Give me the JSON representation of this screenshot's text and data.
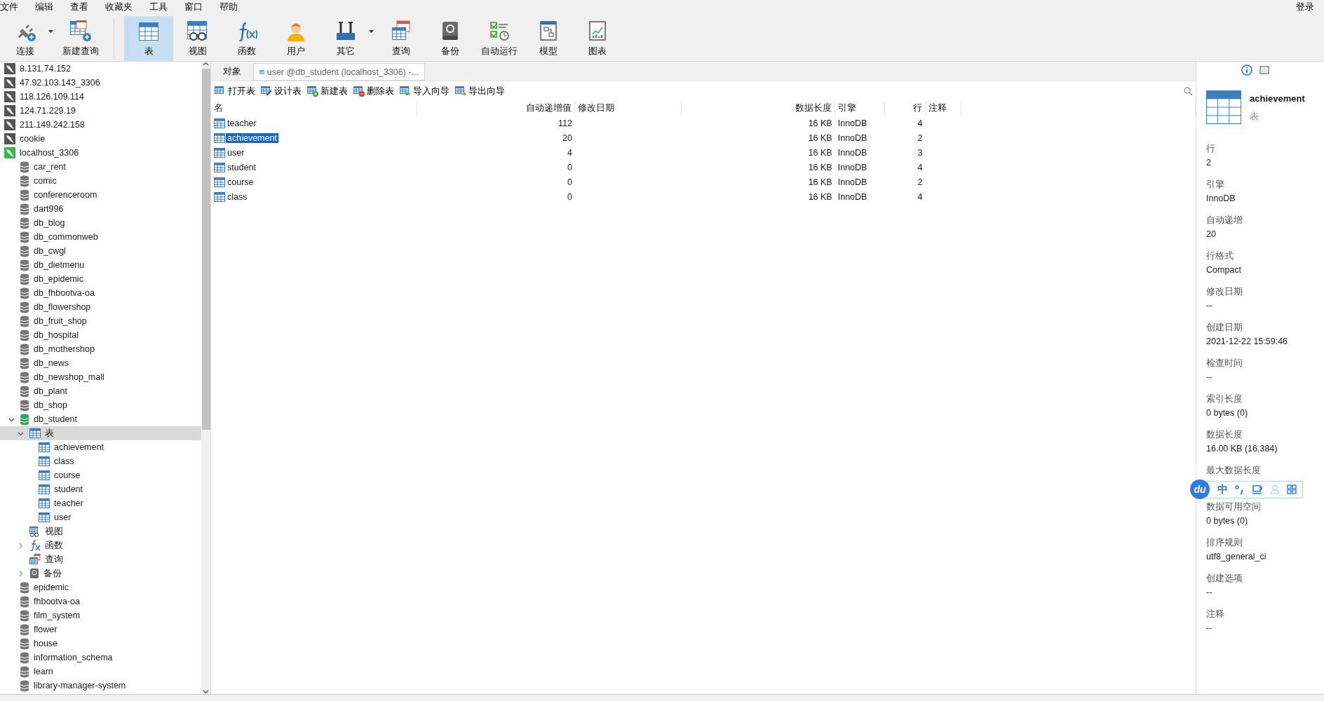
{
  "menu": [
    "文件",
    "编辑",
    "查看",
    "收藏夹",
    "工具",
    "窗口",
    "帮助"
  ],
  "login": "登录",
  "toolbar": [
    {
      "label": "连接",
      "kind": "plug",
      "dropdown": true,
      "selected": false
    },
    {
      "label": "新建查询",
      "kind": "newquery",
      "dropdown": false,
      "selected": false
    },
    {
      "label": "表",
      "kind": "table",
      "dropdown": false,
      "selected": true
    },
    {
      "label": "视图",
      "kind": "view",
      "dropdown": false,
      "selected": false
    },
    {
      "label": "函数",
      "kind": "func",
      "dropdown": false,
      "selected": false
    },
    {
      "label": "用户",
      "kind": "user",
      "dropdown": false,
      "selected": false
    },
    {
      "label": "其它",
      "kind": "tools",
      "dropdown": true,
      "selected": false
    },
    {
      "label": "查询",
      "kind": "query",
      "dropdown": false,
      "selected": false
    },
    {
      "label": "备份",
      "kind": "backup",
      "dropdown": false,
      "selected": false
    },
    {
      "label": "自动运行",
      "kind": "auto",
      "dropdown": false,
      "selected": false
    },
    {
      "label": "模型",
      "kind": "model",
      "dropdown": false,
      "selected": false
    },
    {
      "label": "图表",
      "kind": "chart",
      "dropdown": false,
      "selected": false
    }
  ],
  "tree": [
    {
      "label": "8.131.74.152",
      "kind": "connection",
      "active": false
    },
    {
      "label": "47.92.103.143_3306",
      "kind": "connection",
      "active": false
    },
    {
      "label": "118.126.109.114",
      "kind": "connection",
      "active": false
    },
    {
      "label": "124.71.229.19",
      "kind": "connection",
      "active": false
    },
    {
      "label": "211.149.242.158",
      "kind": "connection",
      "active": false
    },
    {
      "label": "cookie",
      "kind": "connection",
      "active": false
    },
    {
      "label": "localhost_3306",
      "kind": "connection",
      "active": true,
      "children": [
        {
          "label": "car_rent",
          "kind": "database",
          "active": false
        },
        {
          "label": "comic",
          "kind": "database",
          "active": false
        },
        {
          "label": "conferenceroom",
          "kind": "database",
          "active": false
        },
        {
          "label": "dart996",
          "kind": "database",
          "active": false
        },
        {
          "label": "db_blog",
          "kind": "database",
          "active": false
        },
        {
          "label": "db_commonweb",
          "kind": "database",
          "active": false
        },
        {
          "label": "db_cwgl",
          "kind": "database",
          "active": false
        },
        {
          "label": "db_dietmenu",
          "kind": "database",
          "active": false
        },
        {
          "label": "db_epidemic",
          "kind": "database",
          "active": false
        },
        {
          "label": "db_fhbootva-oa",
          "kind": "database",
          "active": false
        },
        {
          "label": "db_flowershop",
          "kind": "database",
          "active": false
        },
        {
          "label": "db_fruit_shop",
          "kind": "database",
          "active": false
        },
        {
          "label": "db_hospital",
          "kind": "database",
          "active": false
        },
        {
          "label": "db_mothershop",
          "kind": "database",
          "active": false
        },
        {
          "label": "db_news",
          "kind": "database",
          "active": false
        },
        {
          "label": "db_newshop_mall",
          "kind": "database",
          "active": false
        },
        {
          "label": "db_plant",
          "kind": "database",
          "active": false
        },
        {
          "label": "db_shop",
          "kind": "database",
          "active": false
        },
        {
          "label": "db_student",
          "kind": "database",
          "active": true,
          "expanded": true,
          "children": [
            {
              "label": "表",
              "kind": "tables",
              "expanded": true,
              "selected": true,
              "children": [
                {
                  "label": "achievement",
                  "kind": "table",
                  "selected": false
                },
                {
                  "label": "class",
                  "kind": "table",
                  "selected": false
                },
                {
                  "label": "course",
                  "kind": "table",
                  "selected": false
                },
                {
                  "label": "student",
                  "kind": "table",
                  "selected": false
                },
                {
                  "label": "teacher",
                  "kind": "table",
                  "selected": false
                },
                {
                  "label": "user",
                  "kind": "table",
                  "selected": false
                }
              ]
            },
            {
              "label": "视图",
              "kind": "views",
              "selected": false
            },
            {
              "label": "函数",
              "kind": "functions",
              "expanded": false,
              "selected": false
            },
            {
              "label": "查询",
              "kind": "queries",
              "selected": false
            },
            {
              "label": "备份",
              "kind": "backups",
              "expanded": false,
              "selected": false
            }
          ]
        },
        {
          "label": "epidemic",
          "kind": "database",
          "active": false
        },
        {
          "label": "fhbootva-oa",
          "kind": "database",
          "active": false
        },
        {
          "label": "film_system",
          "kind": "database",
          "active": false
        },
        {
          "label": "flower",
          "kind": "database",
          "active": false
        },
        {
          "label": "house",
          "kind": "database",
          "active": false
        },
        {
          "label": "information_schema",
          "kind": "database",
          "active": false
        },
        {
          "label": "learn",
          "kind": "database",
          "active": false
        },
        {
          "label": "library-manager-system",
          "kind": "database",
          "active": false
        }
      ]
    }
  ],
  "tabs": [
    {
      "label": "对象",
      "selected": true
    },
    {
      "label": "user @db_student (localhost_3306) -...",
      "selected": false
    }
  ],
  "actions": [
    {
      "label": "打开表",
      "kind": "open"
    },
    {
      "label": "设计表",
      "kind": "design"
    },
    {
      "label": "新建表",
      "kind": "new"
    },
    {
      "label": "删除表",
      "kind": "delete"
    },
    {
      "label": "导入向导",
      "kind": "import"
    },
    {
      "label": "导出向导",
      "kind": "export"
    }
  ],
  "table": {
    "columns": [
      "名",
      "自动递增值",
      "修改日期",
      "数据长度",
      "引擎",
      "行",
      "注释"
    ],
    "rows": [
      {
        "name": "teacher",
        "auto_increment": "112",
        "data_length": "16 KB",
        "engine": "InnoDB",
        "rows": "4",
        "selected": false
      },
      {
        "name": "achievement",
        "auto_increment": "20",
        "data_length": "16 KB",
        "engine": "InnoDB",
        "rows": "2",
        "selected": true
      },
      {
        "name": "user",
        "auto_increment": "4",
        "data_length": "16 KB",
        "engine": "InnoDB",
        "rows": "3",
        "selected": false
      },
      {
        "name": "student",
        "auto_increment": "0",
        "data_length": "16 KB",
        "engine": "InnoDB",
        "rows": "4",
        "selected": false
      },
      {
        "name": "course",
        "auto_increment": "0",
        "data_length": "16 KB",
        "engine": "InnoDB",
        "rows": "2",
        "selected": false
      },
      {
        "name": "class",
        "auto_increment": "0",
        "data_length": "16 KB",
        "engine": "InnoDB",
        "rows": "4",
        "selected": false
      }
    ]
  },
  "info": {
    "title": "achievement",
    "subtitle": "表",
    "properties": [
      {
        "label": "行",
        "value": "2"
      },
      {
        "label": "引擎",
        "value": "InnoDB"
      },
      {
        "label": "自动递增",
        "value": "20"
      },
      {
        "label": "行格式",
        "value": "Compact"
      },
      {
        "label": "修改日期",
        "value": "--"
      },
      {
        "label": "创建日期",
        "value": "2021-12-22 15:59:46"
      },
      {
        "label": "检查时间",
        "value": "--"
      },
      {
        "label": "索引长度",
        "value": "0 bytes (0)"
      },
      {
        "label": "数据长度",
        "value": "16.00 KB (16,384)"
      },
      {
        "label": "最大数据长度"
      },
      {
        "label": "数据可用空间",
        "value": "0 bytes (0)"
      },
      {
        "label": "排序规则",
        "value": "utf8_general_ci"
      },
      {
        "label": "创建选项",
        "value": "--"
      },
      {
        "label": "注释",
        "value": "--"
      }
    ]
  },
  "ime": {
    "logo": "du",
    "mode": "中"
  }
}
